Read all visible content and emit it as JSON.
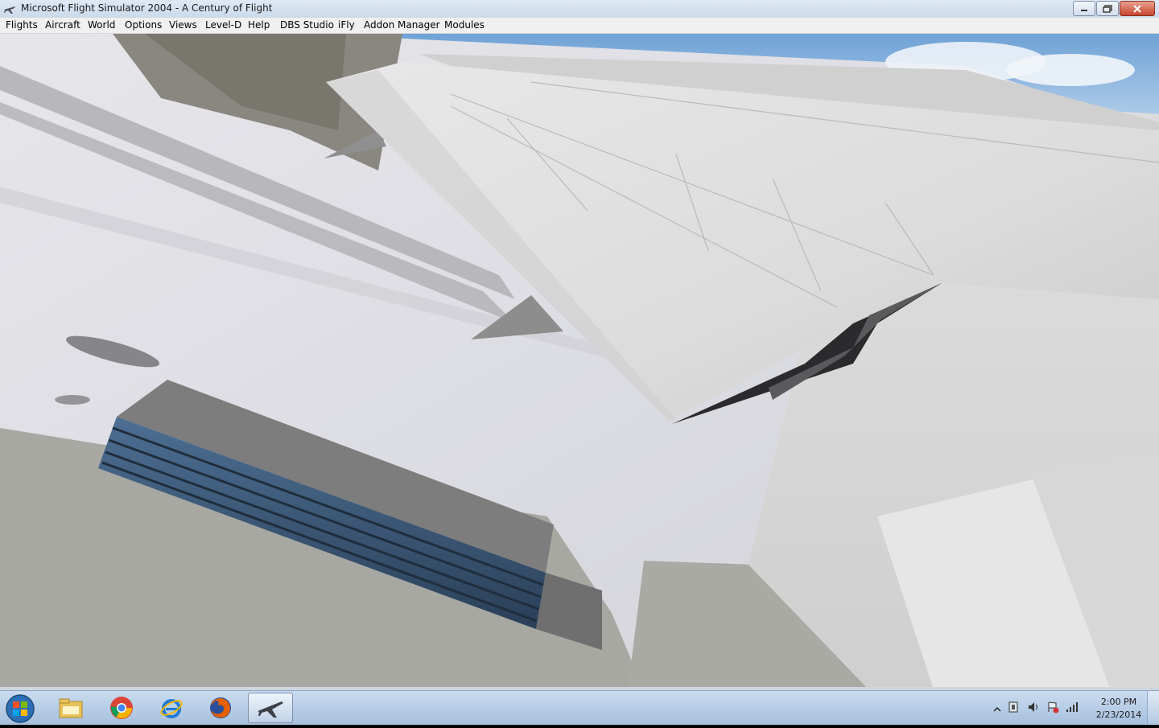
{
  "window": {
    "title": "Microsoft Flight Simulator 2004 - A Century of Flight",
    "controls": [
      "minimize",
      "restore",
      "close"
    ]
  },
  "menu": [
    "Flights",
    "Aircraft",
    "World",
    "Options",
    "Views",
    "Level-D",
    "Help",
    "DBS Studio",
    "iFly",
    "Addon Manager",
    "Modules"
  ],
  "taskbar": {
    "apps": [
      "windows-explorer-icon",
      "chrome-icon",
      "internet-explorer-icon",
      "firefox-icon",
      "flight-simulator-icon"
    ],
    "clock_time": "2:00 PM",
    "clock_date": "2/23/2014"
  }
}
